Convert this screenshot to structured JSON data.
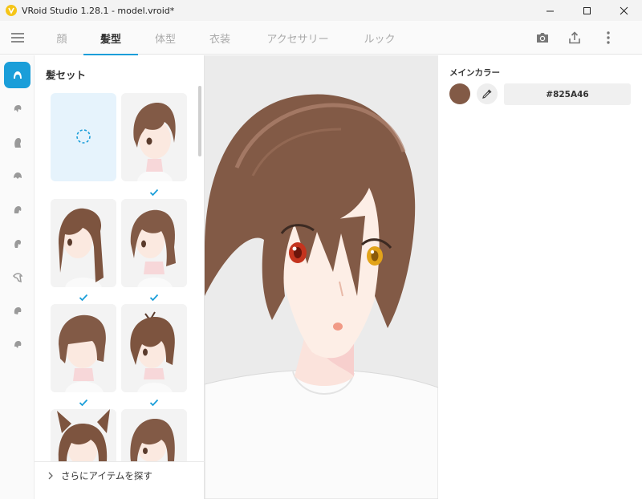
{
  "window": {
    "title": "VRoid Studio 1.28.1 - model.vroid*",
    "icon": "vroid-logo-icon"
  },
  "header": {
    "tabs": [
      {
        "label": "顔",
        "active": false
      },
      {
        "label": "髪型",
        "active": true
      },
      {
        "label": "体型",
        "active": false
      },
      {
        "label": "衣装",
        "active": false
      },
      {
        "label": "アクセサリー",
        "active": false
      },
      {
        "label": "ルック",
        "active": false
      }
    ],
    "icons": [
      "menu-icon",
      "camera-icon",
      "share-icon",
      "more-vert-icon"
    ]
  },
  "rail": {
    "items": [
      {
        "icon": "hair-set-icon",
        "active": true
      },
      {
        "icon": "front-hair-icon",
        "active": false
      },
      {
        "icon": "back-hair-icon",
        "active": false
      },
      {
        "icon": "side-hair-icon",
        "active": false
      },
      {
        "icon": "ahoge-icon",
        "active": false
      },
      {
        "icon": "hair-extra-icon",
        "active": false
      },
      {
        "icon": "hair-strand-icon",
        "active": false
      },
      {
        "icon": "hair-base-icon",
        "active": false
      },
      {
        "icon": "hair-other-icon",
        "active": false
      }
    ]
  },
  "panel": {
    "title": "髪セット",
    "items": [
      {
        "name": "none",
        "checked": false
      },
      {
        "name": "short-bob",
        "checked": true
      },
      {
        "name": "long-straight",
        "checked": true
      },
      {
        "name": "medium-bob",
        "checked": true
      },
      {
        "name": "short-bangs",
        "checked": true
      },
      {
        "name": "short-ahoge",
        "checked": true
      },
      {
        "name": "cat-ears",
        "checked": false
      },
      {
        "name": "bob-round",
        "checked": false
      }
    ],
    "find_more": "さらにアイテムを探す"
  },
  "color_panel": {
    "label": "メインカラー",
    "hex": "#825A46",
    "swatch_color": "#825A46",
    "picker_icon": "eyedropper-icon"
  },
  "colors": {
    "accent": "#1A9ED9",
    "hair": "#825A46"
  }
}
